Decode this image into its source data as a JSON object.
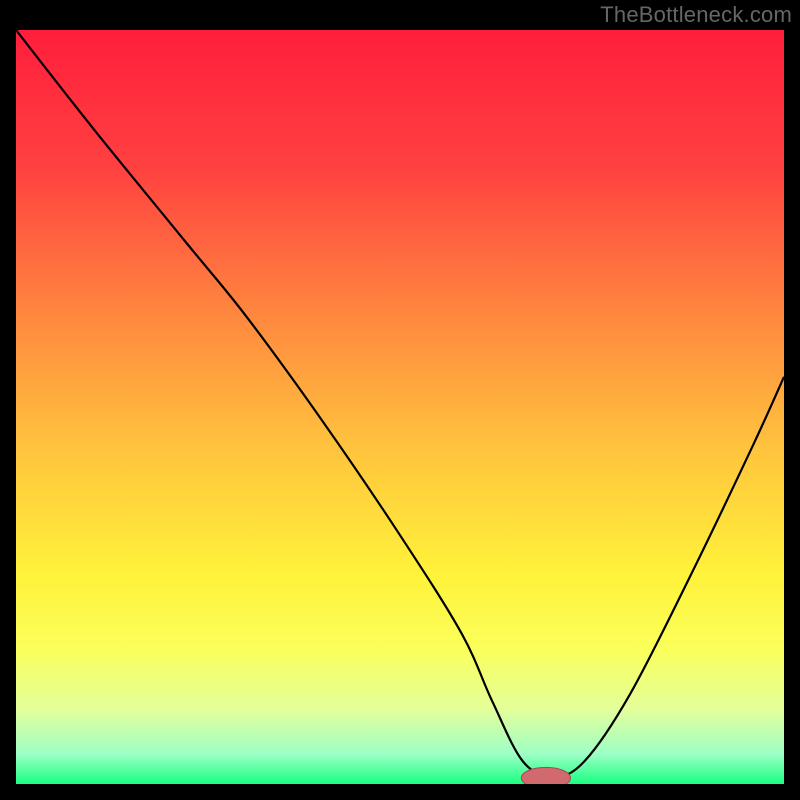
{
  "watermark": "TheBottleneck.com",
  "colors": {
    "background": "#000000",
    "curve": "#000000",
    "marker_fill": "#d06a6f",
    "marker_stroke": "#a8494e",
    "gradient_stops": [
      {
        "offset": 0.0,
        "color": "#ff1e3c"
      },
      {
        "offset": 0.18,
        "color": "#ff4040"
      },
      {
        "offset": 0.38,
        "color": "#ff883f"
      },
      {
        "offset": 0.55,
        "color": "#ffc23d"
      },
      {
        "offset": 0.72,
        "color": "#fff23a"
      },
      {
        "offset": 0.82,
        "color": "#fbff5a"
      },
      {
        "offset": 0.9,
        "color": "#e4ff9a"
      },
      {
        "offset": 0.96,
        "color": "#9dffc5"
      },
      {
        "offset": 1.0,
        "color": "#1aff82"
      }
    ]
  },
  "chart_data": {
    "type": "line",
    "title": "",
    "xlabel": "",
    "ylabel": "",
    "xlim": [
      0,
      100
    ],
    "ylim": [
      0,
      100
    ],
    "series": [
      {
        "name": "bottleneck-curve",
        "x": [
          0,
          10,
          22,
          30,
          40,
          50,
          58,
          62,
          66,
          70,
          74,
          80,
          88,
          96,
          100
        ],
        "values": [
          100,
          87,
          72,
          62,
          48,
          33,
          20,
          11,
          3,
          1,
          3,
          12,
          28,
          45,
          54
        ]
      }
    ],
    "marker": {
      "x": 69,
      "y": 0.8,
      "rx": 3.2,
      "ry": 1.4
    }
  }
}
